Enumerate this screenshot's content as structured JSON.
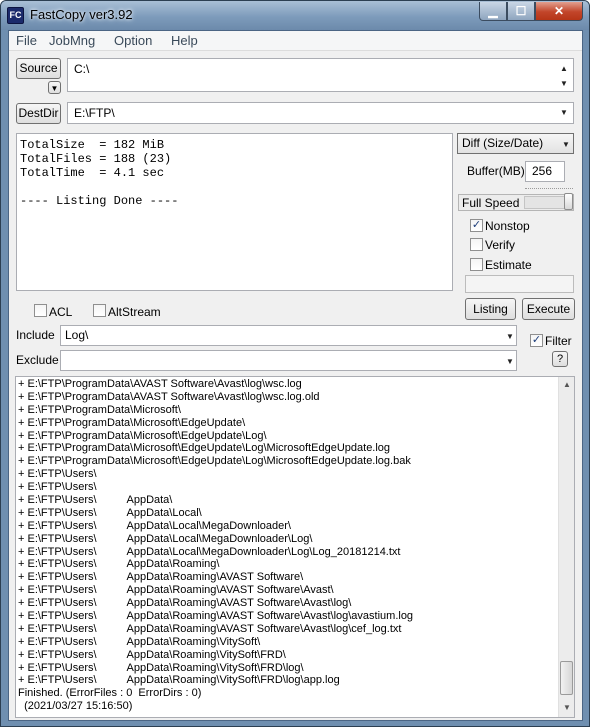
{
  "window": {
    "title": "FastCopy ver3.92",
    "icon_text": "FC"
  },
  "menu": [
    "File",
    "JobMng",
    "Option",
    "Help"
  ],
  "source": {
    "button_label": "Source",
    "value": "C:\\"
  },
  "destdir": {
    "button_label": "DestDir",
    "value": "E:\\FTP\\"
  },
  "status": {
    "lines": [
      "TotalSize  = 182 MiB",
      "TotalFiles = 188 (23)",
      "TotalTime  = 4.1 sec",
      "",
      "---- Listing Done ----"
    ]
  },
  "options": {
    "mode": "Diff (Size/Date)",
    "buffer_label": "Buffer(MB)",
    "buffer_value": "256",
    "speed_label": "Full Speed",
    "nonstop": {
      "label": "Nonstop",
      "checked": true
    },
    "verify": {
      "label": "Verify",
      "checked": false
    },
    "estimate": {
      "label": "Estimate",
      "checked": false
    },
    "acl": {
      "label": "ACL",
      "checked": false
    },
    "altstream": {
      "label": "AltStream",
      "checked": false
    },
    "listing_label": "Listing",
    "execute_label": "Execute"
  },
  "filter": {
    "include_label": "Include",
    "include_value": "Log\\",
    "exclude_label": "Exclude",
    "exclude_value": "",
    "filter_label": "Filter",
    "filter_checked": true,
    "help_label": "?"
  },
  "log": {
    "lines": [
      "+ E:\\FTP\\ProgramData\\AVAST Software\\Avast\\log\\wsc.log",
      "+ E:\\FTP\\ProgramData\\AVAST Software\\Avast\\log\\wsc.log.old",
      "+ E:\\FTP\\ProgramData\\Microsoft\\",
      "+ E:\\FTP\\ProgramData\\Microsoft\\EdgeUpdate\\",
      "+ E:\\FTP\\ProgramData\\Microsoft\\EdgeUpdate\\Log\\",
      "+ E:\\FTP\\ProgramData\\Microsoft\\EdgeUpdate\\Log\\MicrosoftEdgeUpdate.log",
      "+ E:\\FTP\\ProgramData\\Microsoft\\EdgeUpdate\\Log\\MicrosoftEdgeUpdate.log.bak",
      "+ E:\\FTP\\Users\\",
      "+ E:\\FTP\\Users\\",
      "+ E:\\FTP\\Users\\          AppData\\",
      "+ E:\\FTP\\Users\\          AppData\\Local\\",
      "+ E:\\FTP\\Users\\          AppData\\Local\\MegaDownloader\\",
      "+ E:\\FTP\\Users\\          AppData\\Local\\MegaDownloader\\Log\\",
      "+ E:\\FTP\\Users\\          AppData\\Local\\MegaDownloader\\Log\\Log_20181214.txt",
      "+ E:\\FTP\\Users\\          AppData\\Roaming\\",
      "+ E:\\FTP\\Users\\          AppData\\Roaming\\AVAST Software\\",
      "+ E:\\FTP\\Users\\          AppData\\Roaming\\AVAST Software\\Avast\\",
      "+ E:\\FTP\\Users\\          AppData\\Roaming\\AVAST Software\\Avast\\log\\",
      "+ E:\\FTP\\Users\\          AppData\\Roaming\\AVAST Software\\Avast\\log\\avastium.log",
      "+ E:\\FTP\\Users\\          AppData\\Roaming\\AVAST Software\\Avast\\log\\cef_log.txt",
      "+ E:\\FTP\\Users\\          AppData\\Roaming\\VitySoft\\",
      "+ E:\\FTP\\Users\\          AppData\\Roaming\\VitySoft\\FRD\\",
      "+ E:\\FTP\\Users\\          AppData\\Roaming\\VitySoft\\FRD\\log\\",
      "+ E:\\FTP\\Users\\          AppData\\Roaming\\VitySoft\\FRD\\log\\app.log",
      "Finished. (ErrorFiles : 0  ErrorDirs : 0)",
      "  (2021/03/27 15:16:50)"
    ]
  },
  "colors": {
    "title_bar": "#7d9bbb",
    "close_button": "#c2452a",
    "frame": "#6f8fb0"
  }
}
